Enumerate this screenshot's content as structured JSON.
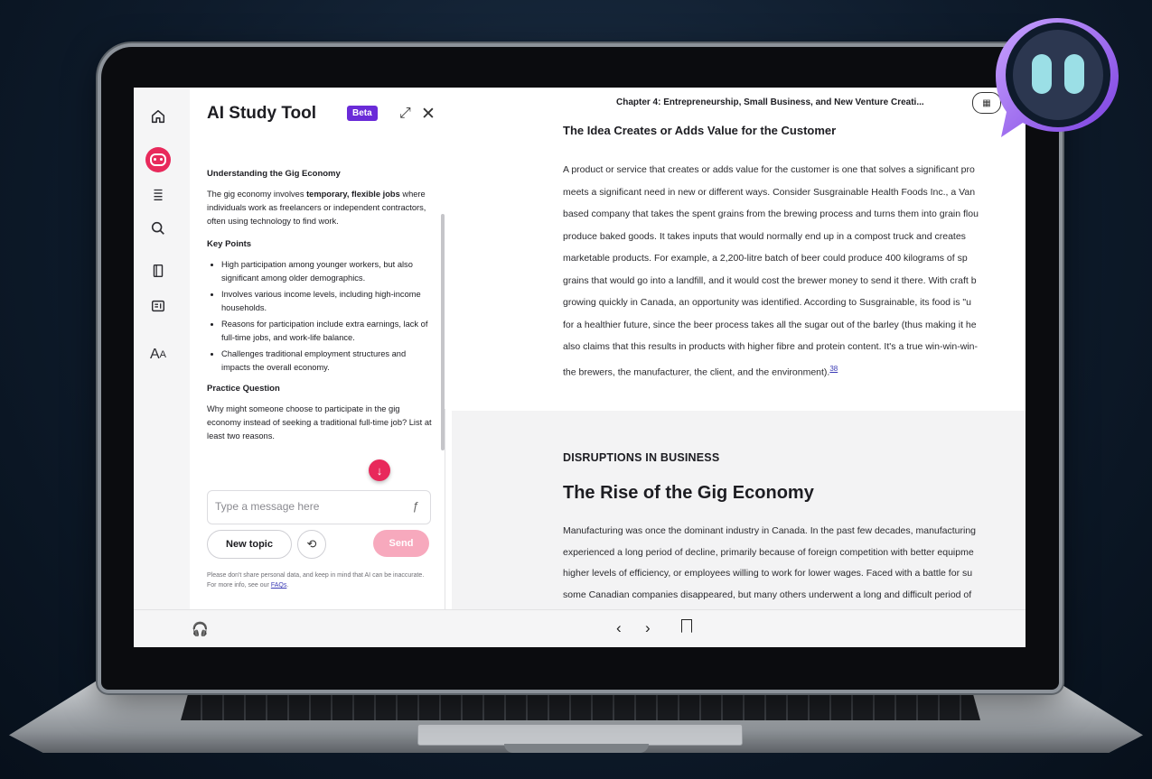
{
  "panel": {
    "title": "AI Study Tool",
    "badge": "Beta",
    "heading": "Understanding the Gig Economy",
    "intro_before": "The gig economy involves ",
    "intro_bold": "temporary, flexible jobs",
    "intro_after": " where individuals work as freelancers or independent contractors, often using technology to find work.",
    "key_points_heading": "Key Points",
    "key_points": [
      "High participation among younger workers, but also significant among older demographics.",
      "Involves various income levels, including high-income households.",
      "Reasons for participation include extra earnings, lack of full-time jobs, and work-life balance.",
      "Challenges traditional employment structures and impacts the overall economy."
    ],
    "practice_heading": "Practice Question",
    "practice_text": "Why might someone choose to participate in the gig economy instead of seeking a traditional full-time job? List at least two reasons.",
    "input_placeholder": "Type a message here",
    "new_topic_label": "New topic",
    "send_label": "Send",
    "disclaimer": "Please don't share personal data, and keep in mind that AI can be inaccurate. For more info, see our",
    "faqs_link": "FAQs",
    "disclaimer_end": "."
  },
  "reader": {
    "chapter_title": "Chapter 4: Entrepreneurship, Small Business, and New Venture Creati...",
    "section1_heading": "The Idea Creates or Adds Value for the Customer",
    "section1_lines": [
      "A product or service that creates or adds value for the customer is one that solves a significant pro",
      "meets a significant need in new or different ways. Consider Susgrainable Health Foods Inc., a Van",
      "based company that takes the spent grains from the brewing process and turns them into grain flou",
      "produce baked goods. It takes inputs that would normally end up in a compost truck and creates",
      "marketable products. For example, a 2,200-litre batch of beer could produce 400 kilograms of sp",
      "grains that would go into a landfill, and it would cost the brewer money to send it there. With craft b",
      "growing quickly in Canada, an opportunity was identified. According to Susgrainable, its food is \"u",
      "for a healthier future, since the beer process takes all the sugar out of the barley (thus making it he",
      "also claims that this results in products with higher fibre and protein content. It's a true win-win-win-"
    ],
    "section1_last_line": "the brewers, the manufacturer, the client, and the environment).",
    "footnote_ref": "38",
    "section2_kicker": "DISRUPTIONS IN BUSINESS",
    "section2_heading": "The Rise of the Gig Economy",
    "section2_lines": [
      "Manufacturing was once the dominant industry in Canada. In the past few decades, manufacturing",
      "experienced a long period of decline, primarily because of foreign competition with better equipme",
      "higher levels of efficiency, or employees willing to work for lower wages. Faced with a battle for su",
      "some Canadian companies disappeared, but many others underwent a long and difficult period of"
    ]
  },
  "icons": {
    "rail": [
      "home-icon",
      "ai-assistant-icon",
      "contents-icon",
      "search-icon",
      "notebook-icon",
      "flashcards-icon",
      "text-size-icon"
    ],
    "bottom": [
      "audio-icon",
      "prev-page-icon",
      "next-page-icon",
      "bookmark-icon"
    ]
  },
  "colors": {
    "accent": "#e8295b",
    "badge": "#6a2bd8",
    "send_disabled": "#f7a9bd",
    "mascot": "#9bdfe6"
  }
}
